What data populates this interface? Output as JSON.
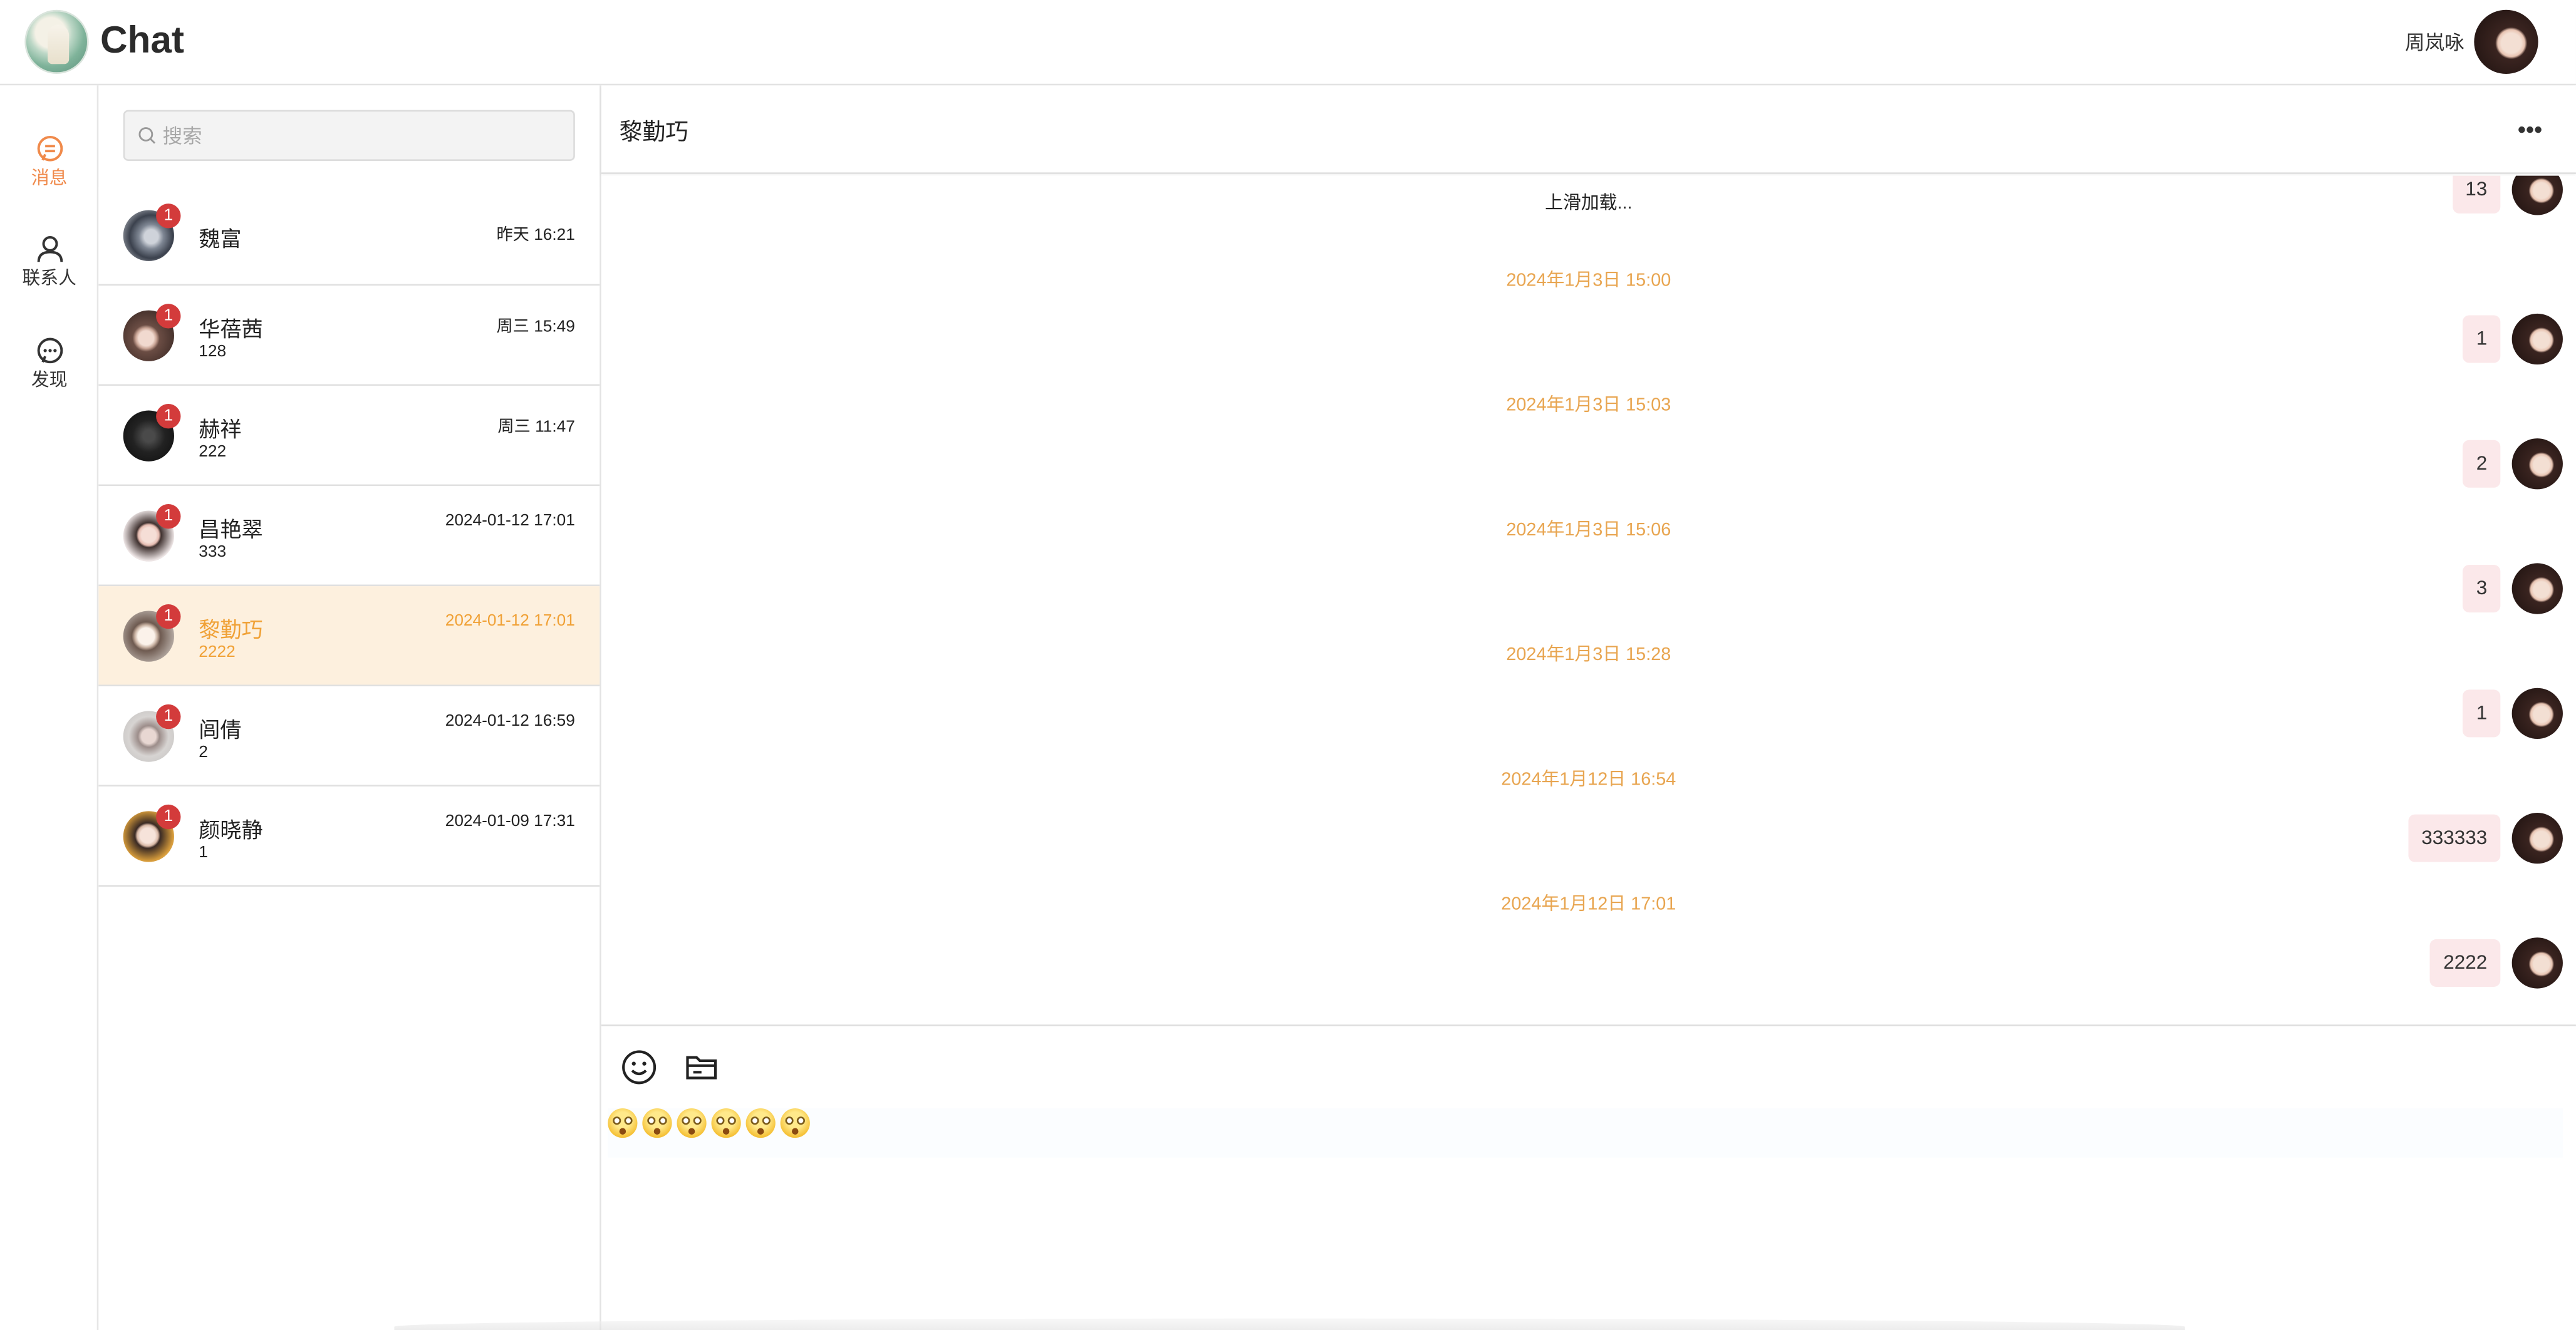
{
  "header": {
    "app_title": "Chat",
    "user_name": "周岚咏"
  },
  "nav": [
    {
      "label": "消息",
      "icon": "message-icon",
      "active": true
    },
    {
      "label": "联系人",
      "icon": "contacts-icon",
      "active": false
    },
    {
      "label": "发现",
      "icon": "discover-icon",
      "active": false
    }
  ],
  "search": {
    "placeholder": "搜索"
  },
  "conversations": [
    {
      "name": "魏富",
      "preview": "",
      "time": "昨天 16:21",
      "badge": "1"
    },
    {
      "name": "华蓓茜",
      "preview": "128",
      "time": "周三 15:49",
      "badge": "1"
    },
    {
      "name": "赫祥",
      "preview": "222",
      "time": "周三 11:47",
      "badge": "1"
    },
    {
      "name": "昌艳翠",
      "preview": "333",
      "time": "2024-01-12 17:01",
      "badge": "1"
    },
    {
      "name": "黎勤巧",
      "preview": "2222",
      "time": "2024-01-12 17:01",
      "badge": "1",
      "active": true
    },
    {
      "name": "闾倩",
      "preview": "2",
      "time": "2024-01-12 16:59",
      "badge": "1"
    },
    {
      "name": "颜晓静",
      "preview": "1",
      "time": "2024-01-09 17:31",
      "badge": "1"
    }
  ],
  "chat": {
    "title": "黎勤巧",
    "load_more": "上滑加载...",
    "partial_message": "13",
    "blocks": [
      {
        "time": "2024年1月3日 15:00",
        "message": "1"
      },
      {
        "time": "2024年1月3日 15:03",
        "message": "2"
      },
      {
        "time": "2024年1月3日 15:06",
        "message": "3"
      },
      {
        "time": "2024年1月3日 15:28",
        "message": "1"
      },
      {
        "time": "2024年1月12日 16:54",
        "message": "333333"
      },
      {
        "time": "2024年1月12日 17:01",
        "message": "2222"
      }
    ]
  },
  "composer": {
    "tools": [
      "emoji-icon",
      "folder-icon"
    ],
    "emoji_count": 6
  },
  "colors": {
    "accent": "#f08a4b",
    "active_bg": "#fdf0de",
    "badge": "#d33b3b",
    "timestamp": "#e8a550",
    "bubble": "#fbe8ea"
  }
}
